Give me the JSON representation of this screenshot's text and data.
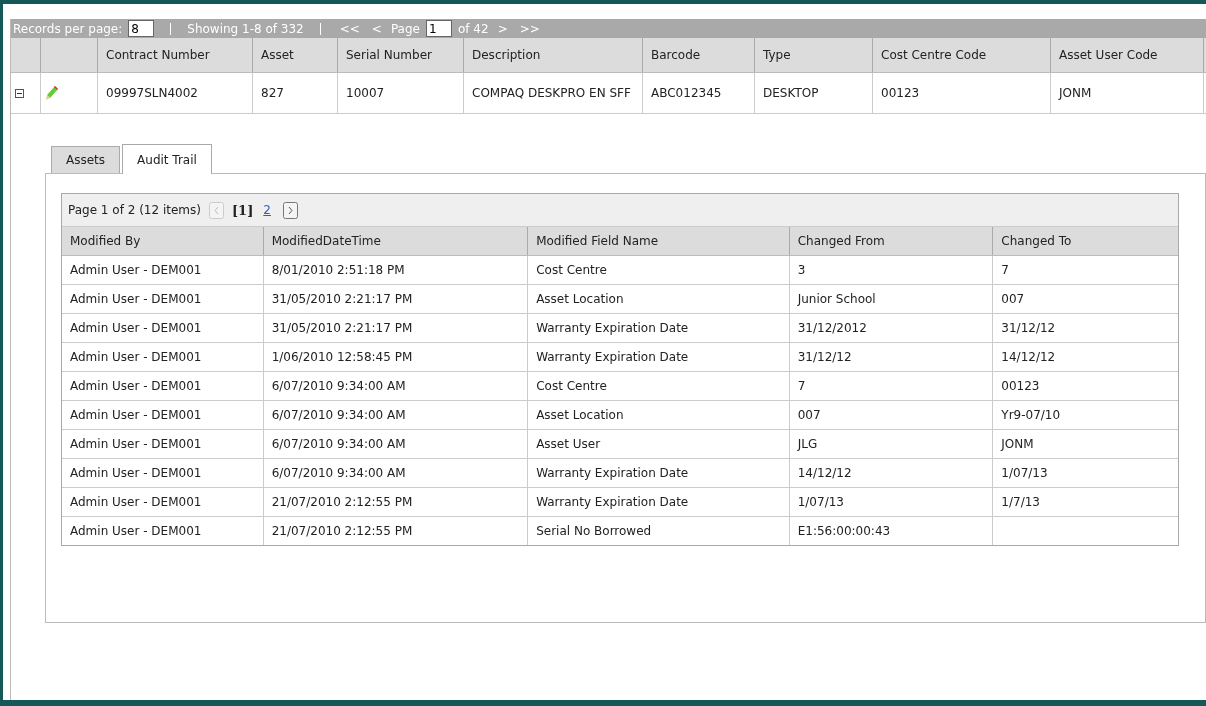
{
  "pager": {
    "records_label": "Records per page:",
    "records_value": "8",
    "showing": "Showing 1-8 of 332",
    "first": "<<",
    "prev": "<",
    "page_label": "Page",
    "page_value": "1",
    "of_pages": "of 42",
    "next": ">",
    "last": ">>"
  },
  "grid": {
    "columns": [
      "Contract Number",
      "Asset",
      "Serial Number",
      "Description",
      "Barcode",
      "Type",
      "Cost Centre Code",
      "Asset User Code"
    ],
    "rows": [
      {
        "expanded": true,
        "cells": [
          "09997SLN4002",
          "827",
          "10007",
          "COMPAQ DESKPRO EN SFF",
          "ABC012345",
          "DESKTOP",
          "00123",
          "JONM"
        ]
      }
    ]
  },
  "tabs": [
    {
      "label": "Assets",
      "selected": false
    },
    {
      "label": "Audit Trail",
      "selected": true
    }
  ],
  "audit": {
    "pager": {
      "summary": "Page 1 of 2 (12 items)",
      "pages": [
        {
          "label": "[1]",
          "selected": true
        },
        {
          "label": "2",
          "selected": false
        }
      ]
    },
    "columns": [
      "Modified By",
      "ModifiedDateTime",
      "Modified Field Name",
      "Changed From",
      "Changed To"
    ],
    "rows": [
      [
        "Admin User - DEM001",
        "8/01/2010 2:51:18 PM",
        "Cost Centre",
        "3",
        "7"
      ],
      [
        "Admin User - DEM001",
        "31/05/2010 2:21:17 PM",
        "Asset Location",
        "Junior School",
        "007"
      ],
      [
        "Admin User - DEM001",
        "31/05/2010 2:21:17 PM",
        "Warranty Expiration Date",
        "31/12/2012",
        "31/12/12"
      ],
      [
        "Admin User - DEM001",
        "1/06/2010 12:58:45 PM",
        "Warranty Expiration Date",
        "31/12/12",
        "14/12/12"
      ],
      [
        "Admin User - DEM001",
        "6/07/2010 9:34:00 AM",
        "Cost Centre",
        "7",
        "00123"
      ],
      [
        "Admin User - DEM001",
        "6/07/2010 9:34:00 AM",
        "Asset Location",
        "007",
        "Yr9-07/10"
      ],
      [
        "Admin User - DEM001",
        "6/07/2010 9:34:00 AM",
        "Asset User",
        "JLG",
        "JONM"
      ],
      [
        "Admin User - DEM001",
        "6/07/2010 9:34:00 AM",
        "Warranty Expiration Date",
        "14/12/12",
        "1/07/13"
      ],
      [
        "Admin User - DEM001",
        "21/07/2010 2:12:55 PM",
        "Warranty Expiration Date",
        "1/07/13",
        "1/7/13"
      ],
      [
        "Admin User - DEM001",
        "21/07/2010 2:12:55 PM",
        "Serial No Borrowed",
        "E1:56:00:00:43",
        ""
      ]
    ]
  }
}
